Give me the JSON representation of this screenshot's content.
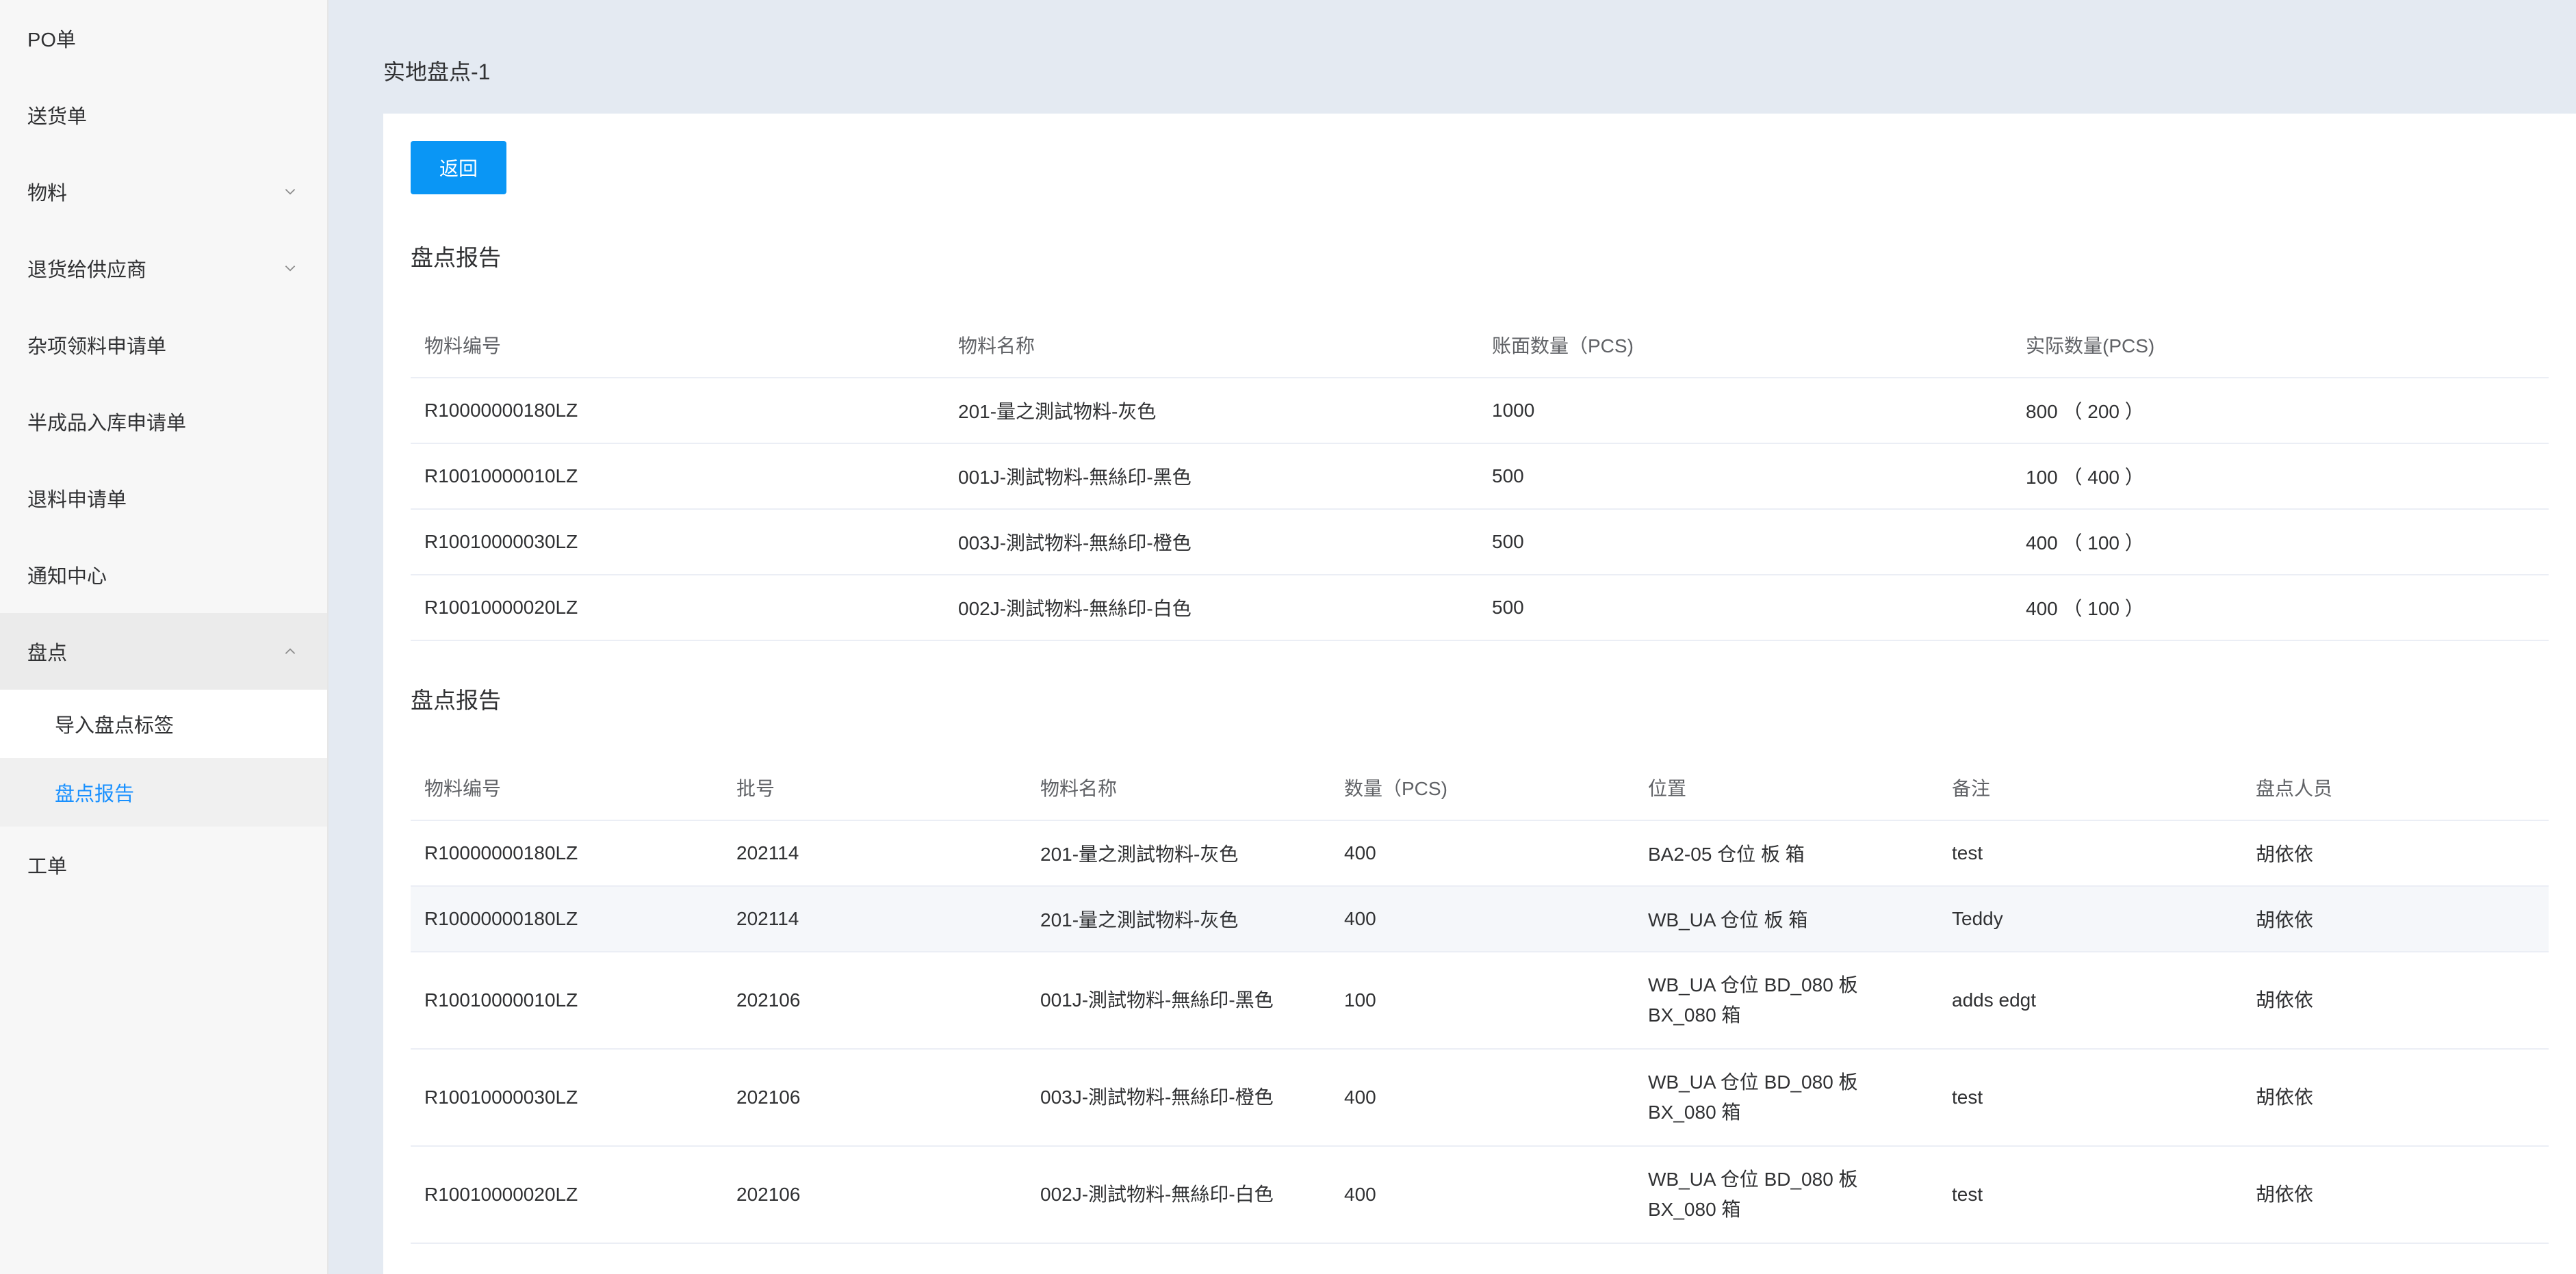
{
  "sidebar": {
    "items": [
      {
        "label": "PO单"
      },
      {
        "label": "送货单"
      },
      {
        "label": "物料"
      },
      {
        "label": "退货给供应商"
      },
      {
        "label": "杂项领料申请单"
      },
      {
        "label": "半成品入库申请单"
      },
      {
        "label": "退料申请单"
      },
      {
        "label": "通知中心"
      },
      {
        "label": "盘点"
      },
      {
        "label": "工单"
      }
    ],
    "sub_items": [
      {
        "label": "导入盘点标签"
      },
      {
        "label": "盘点报告"
      }
    ]
  },
  "page": {
    "title": "实地盘点-1",
    "back_label": "返回"
  },
  "report1": {
    "title": "盘点报告",
    "headers": [
      "物料编号",
      "物料名称",
      "账面数量（PCS)",
      "实际数量(PCS)"
    ],
    "rows": [
      [
        "R10000000180LZ",
        "201-量之測試物料-灰色",
        "1000",
        "800 （ 200 ）"
      ],
      [
        "R10010000010LZ",
        "001J-測試物料-無絲印-黑色",
        "500",
        "100 （ 400 ）"
      ],
      [
        "R10010000030LZ",
        "003J-測試物料-無絲印-橙色",
        "500",
        "400 （ 100 ）"
      ],
      [
        "R10010000020LZ",
        "002J-測試物料-無絲印-白色",
        "500",
        "400 （ 100 ）"
      ]
    ]
  },
  "report2": {
    "title": "盘点报告",
    "headers": [
      "物料编号",
      "批号",
      "物料名称",
      "数量（PCS)",
      "位置",
      "备注",
      "盘点人员"
    ],
    "rows": [
      [
        "R10000000180LZ",
        "202114",
        "201-量之測試物料-灰色",
        "400",
        "BA2-05 仓位 板 箱",
        "test",
        "胡依依"
      ],
      [
        "R10000000180LZ",
        "202114",
        "201-量之測試物料-灰色",
        "400",
        "WB_UA 仓位 板 箱",
        "Teddy",
        "胡依依"
      ],
      [
        "R10010000010LZ",
        "202106",
        "001J-測試物料-無絲印-黑色",
        "100",
        "WB_UA 仓位 BD_080 板 BX_080 箱",
        "adds edgt",
        "胡依依"
      ],
      [
        "R10010000030LZ",
        "202106",
        "003J-測試物料-無絲印-橙色",
        "400",
        "WB_UA 仓位 BD_080 板 BX_080 箱",
        "test",
        "胡依依"
      ],
      [
        "R10010000020LZ",
        "202106",
        "002J-測試物料-無絲印-白色",
        "400",
        "WB_UA 仓位 BD_080 板 BX_080 箱",
        "test",
        "胡依依"
      ]
    ]
  },
  "colors": {
    "accent": "#1890ff",
    "button": "#0a96f5",
    "sidebar_bg": "#f7f7f7",
    "main_bg": "#e4eaf2"
  }
}
